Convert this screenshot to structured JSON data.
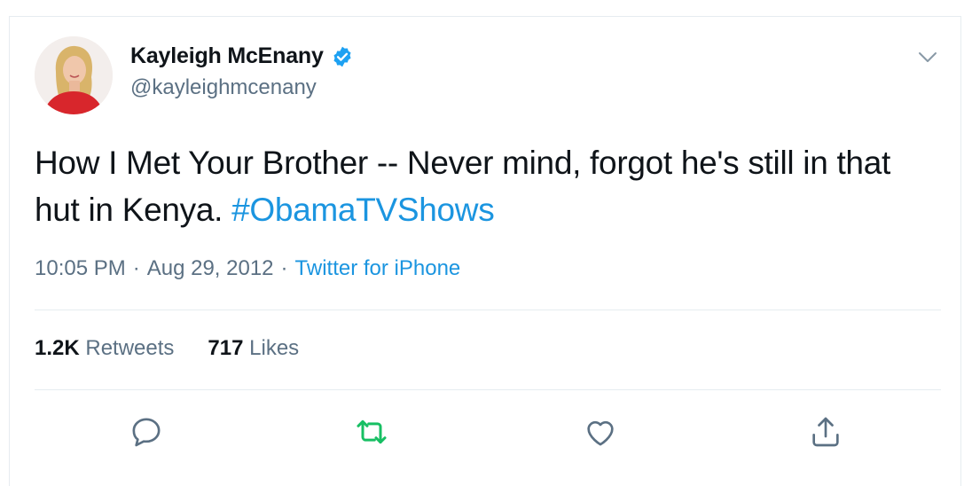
{
  "author": {
    "display_name": "Kayleigh McEnany",
    "handle": "@kayleighmcenany",
    "verified": true
  },
  "tweet": {
    "text_main": "How I Met Your Brother -- Never mind, forgot he's still in that hut in Kenya. ",
    "hashtag": "#ObamaTVShows",
    "time": "10:05 PM",
    "separator": "·",
    "date": "Aug 29, 2012",
    "source": "Twitter for iPhone"
  },
  "stats": {
    "retweets_count": "1.2K",
    "retweets_label": "Retweets",
    "likes_count": "717",
    "likes_label": "Likes"
  },
  "icons": {
    "menu": "chevron-down-icon",
    "reply": "reply-icon",
    "retweet": "retweet-icon",
    "like": "heart-icon",
    "share": "share-icon",
    "verified": "verified-badge-icon"
  },
  "colors": {
    "accent": "#1b95e0",
    "retweet_green": "#17bf63",
    "secondary_text": "#5b7083",
    "primary_text": "#0f1419"
  }
}
